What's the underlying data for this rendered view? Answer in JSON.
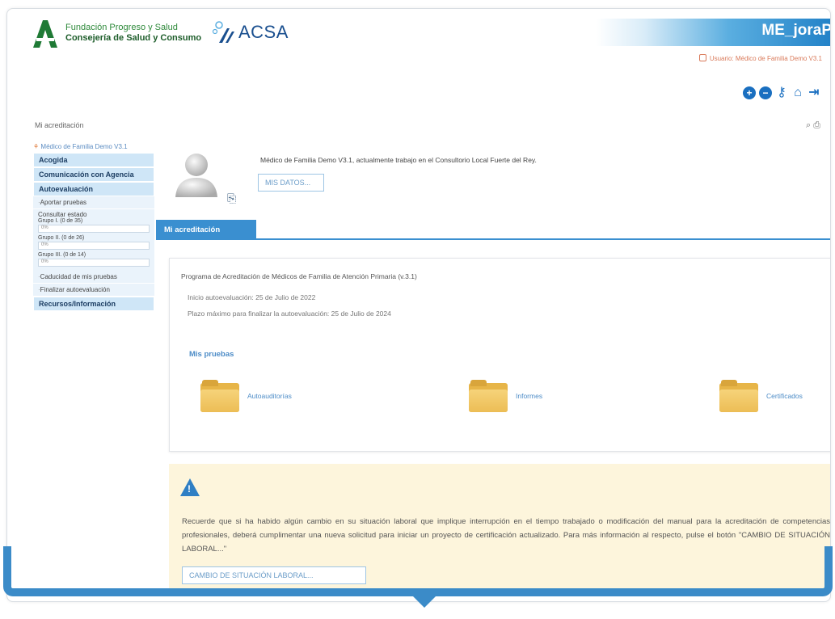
{
  "header": {
    "logo_line1": "Fundación Progreso y Salud",
    "logo_line2": "Consejería de Salud y Consumo",
    "acsa": "ACSA",
    "app_title": "ME_joraP",
    "user_line": "Usuario: Médico de Familia Demo V3.1",
    "breadcrumb": "Mi acreditación"
  },
  "sidebar": {
    "user": "Médico de Familia Demo V3.1",
    "acogida": "Acogida",
    "comunicacion": "Comunicación con Agencia",
    "autoevaluacion": "Autoevaluación",
    "aportar": "Aportar pruebas",
    "consultar": "Consultar estado",
    "groups": [
      {
        "label": "Grupo I. (0 de 35)",
        "value": "0%"
      },
      {
        "label": "Grupo II. (0 de 26)",
        "value": "0%"
      },
      {
        "label": "Grupo III. (0 de 14)",
        "value": "0%"
      }
    ],
    "caducidad": "Caducidad de mis pruebas",
    "finalizar": "Finalizar autoevaluación",
    "recursos": "Recursos/Información"
  },
  "profile": {
    "text": "Médico de Familia Demo V3.1, actualmente trabajo en el Consultorio Local Fuerte del Rey.",
    "button": "MIS DATOS..."
  },
  "tab": {
    "label": "Mi acreditación"
  },
  "card": {
    "title": "Programa de Acreditación de Médicos de Familia de Atención Primaria (v.3.1)",
    "inicio": "Inicio autoevaluación: 25 de Julio de 2022",
    "plazo": "Plazo máximo para finalizar la autoevaluación: 25 de Julio de 2024",
    "section": "Mis pruebas",
    "folders": [
      "Autoauditorías",
      "Informes",
      "Certificados"
    ]
  },
  "notice": {
    "text": "Recuerde que si ha habido algún cambio en su situación laboral que implique interrupción en el tiempo trabajado o modificación del manual para la acreditación de competencias profesionales, deberá cumplimentar una nueva solicitud para iniciar un proyecto de certificación actualizado. Para más información al respecto, pulse el botón \"CAMBIO DE SITUACIÓN LABORAL...\"",
    "button": "CAMBIO DE SITUACIÓN LABORAL..."
  },
  "colors": {
    "accent": "#3a8fd0",
    "notice_bg": "#fdf5dc",
    "folder": "#e7b548"
  }
}
